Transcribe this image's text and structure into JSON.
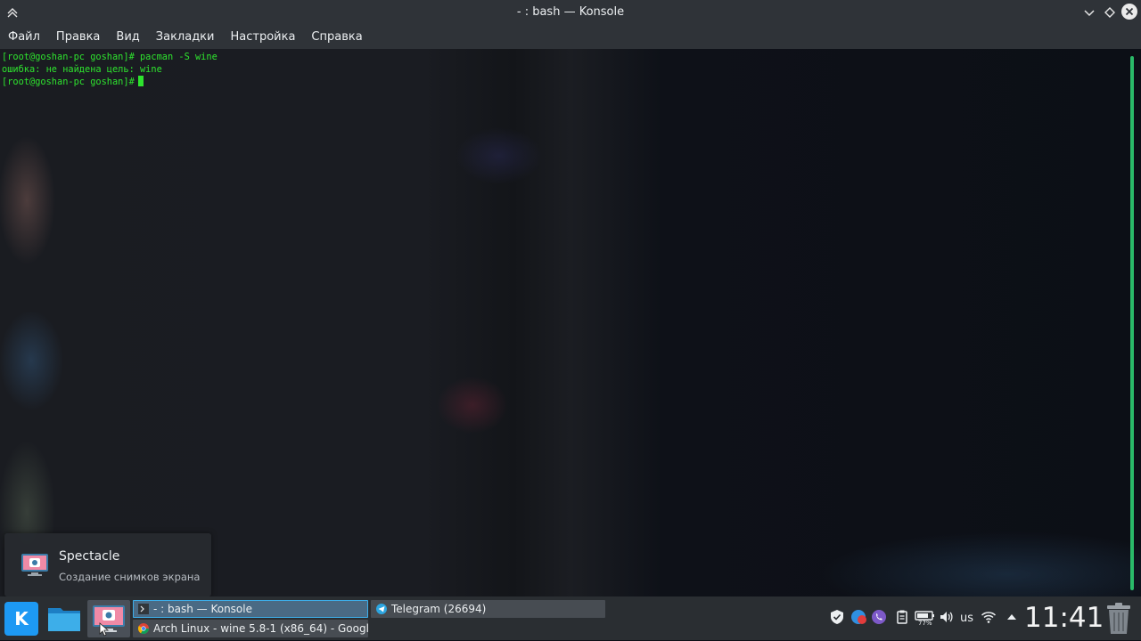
{
  "window": {
    "title": "- : bash — Konsole"
  },
  "menu": {
    "items": [
      "Файл",
      "Правка",
      "Вид",
      "Закладки",
      "Настройка",
      "Справка"
    ]
  },
  "terminal": {
    "lines": [
      "[root@goshan-pc goshan]# pacman -S wine",
      "ошибка: не найдена цель: wine",
      "[root@goshan-pc goshan]#"
    ],
    "text_color": "#2ee32e"
  },
  "notification": {
    "title": "Spectacle",
    "body": "Создание снимков экрана"
  },
  "taskbar": {
    "tasks": [
      {
        "label": "- : bash — Konsole"
      },
      {
        "label": "Arch Linux - wine 5.8-1 (x86_64) - Googl..."
      },
      {
        "label": "Telegram (26694)"
      }
    ],
    "tray": {
      "keyboard_layout": "us",
      "battery_label": "77%",
      "clock": "11:41"
    }
  },
  "colors": {
    "accent": "#3daee9",
    "kde_blue": "#1d99f3"
  }
}
